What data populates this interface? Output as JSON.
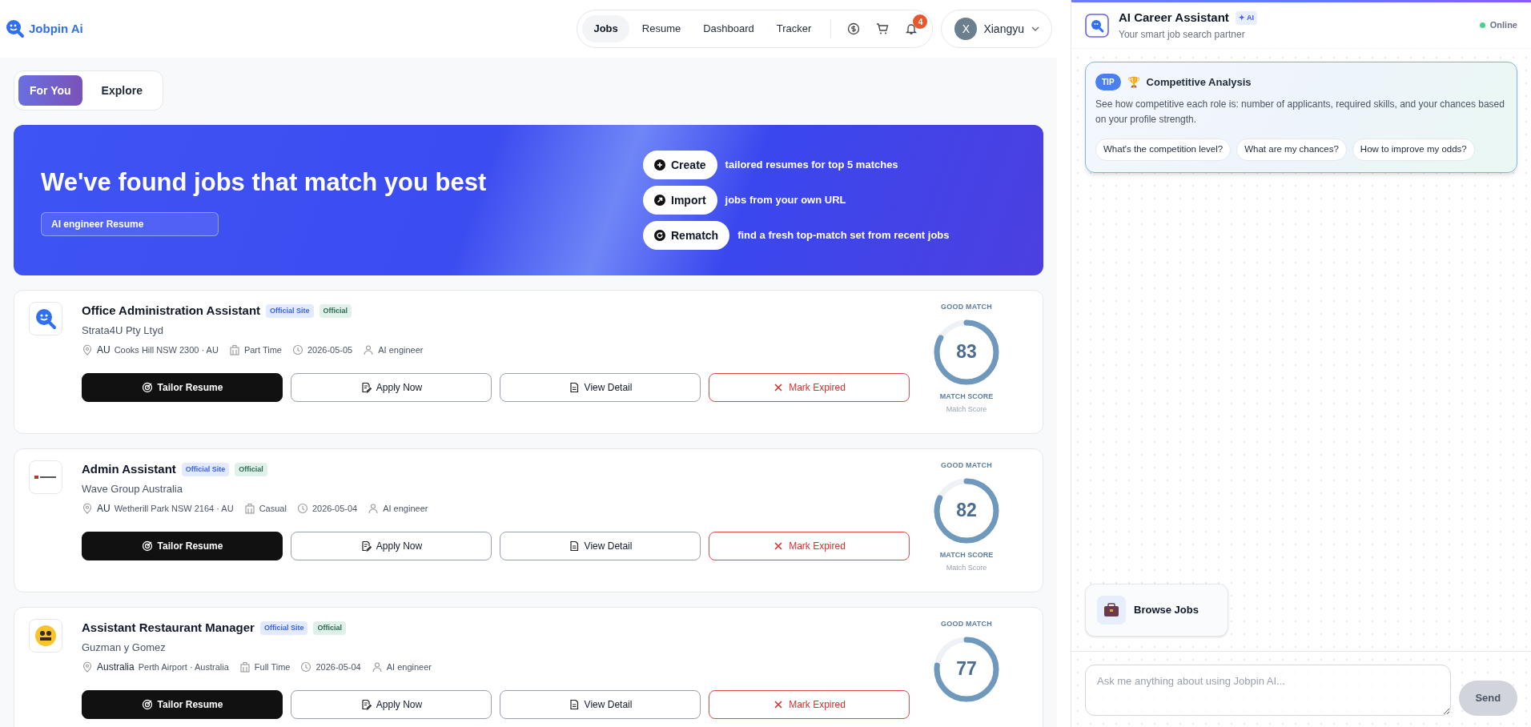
{
  "header": {
    "brand": "Jobpin Ai",
    "nav": [
      {
        "label": "Jobs",
        "selected": true
      },
      {
        "label": "Resume",
        "selected": false
      },
      {
        "label": "Dashboard",
        "selected": false
      },
      {
        "label": "Tracker",
        "selected": false
      }
    ],
    "notification_count": "4",
    "user": {
      "initial": "X",
      "name": "Xiangyu"
    }
  },
  "view_tabs": [
    {
      "label": "For You",
      "selected": true
    },
    {
      "label": "Explore",
      "selected": false
    }
  ],
  "banner": {
    "title": "We've found jobs that match you best",
    "resume_field": "AI engineer Resume",
    "actions": [
      {
        "kind": "create",
        "label": "Create",
        "text": "tailored resumes for top 5 matches"
      },
      {
        "kind": "import",
        "label": "Import",
        "text": "jobs from your own URL"
      },
      {
        "kind": "rematch",
        "label": "Rematch",
        "text": "find a fresh top-match set from recent jobs"
      }
    ]
  },
  "jobs": [
    {
      "logo": {
        "kind": "mark"
      },
      "title": "Office Administration Assistant",
      "tags": [
        "Official Site",
        "Official"
      ],
      "company": "Strata4U Pty Ltyd",
      "country": "AU",
      "place": "Cooks Hill NSW 2300 · AU",
      "type": "Part Time",
      "date": "2026-05-05",
      "resume": "AI engineer",
      "buttons": [
        "Tailor Resume",
        "Apply Now",
        "View Detail",
        "Mark Expired"
      ],
      "match_label": "GOOD MATCH",
      "score": "83",
      "level": 0.83,
      "score_label": "MATCH SCORE",
      "score_caption": "Match Score"
    },
    {
      "logo": {
        "kind": "wordmark"
      },
      "title": "Admin Assistant",
      "tags": [
        "Official Site",
        "Official"
      ],
      "company": "Wave Group Australia",
      "country": "AU",
      "place": "Wetherill Park NSW 2164 · AU",
      "type": "Casual",
      "date": "2026-05-04",
      "resume": "AI engineer",
      "buttons": [
        "Tailor Resume",
        "Apply Now",
        "View Detail",
        "Mark Expired"
      ],
      "match_label": "GOOD MATCH",
      "score": "82",
      "level": 0.82,
      "score_label": "MATCH SCORE",
      "score_caption": "Match Score"
    },
    {
      "logo": {
        "kind": "badge"
      },
      "title": "Assistant Restaurant Manager",
      "tags": [
        "Official Site",
        "Official"
      ],
      "company": "Guzman y Gomez",
      "country": "Australia",
      "place": "Perth Airport · Australia",
      "type": "Full Time",
      "date": "2026-05-04",
      "resume": "AI engineer",
      "buttons": [
        "Tailor Resume",
        "Apply Now",
        "View Detail",
        "Mark Expired"
      ],
      "match_label": "GOOD MATCH",
      "score": "77",
      "level": 0.77
    }
  ],
  "assistant": {
    "title": "AI Career Assistant",
    "badge": "✦ AI",
    "subtitle": "Your smart job search partner",
    "status": "Online",
    "tip": {
      "badge": "TIP",
      "emoji": "🏆",
      "title": "Competitive Analysis",
      "text": "See how competitive each role is: number of applicants, required skills, and your chances based on your profile strength.",
      "suggestions": [
        "What's the competition level?",
        "What are my chances?",
        "How to improve my odds?"
      ]
    },
    "quick_action": "Browse Jobs",
    "input_placeholder": "Ask me anything about using Jobpin AI...",
    "send": "Send"
  }
}
